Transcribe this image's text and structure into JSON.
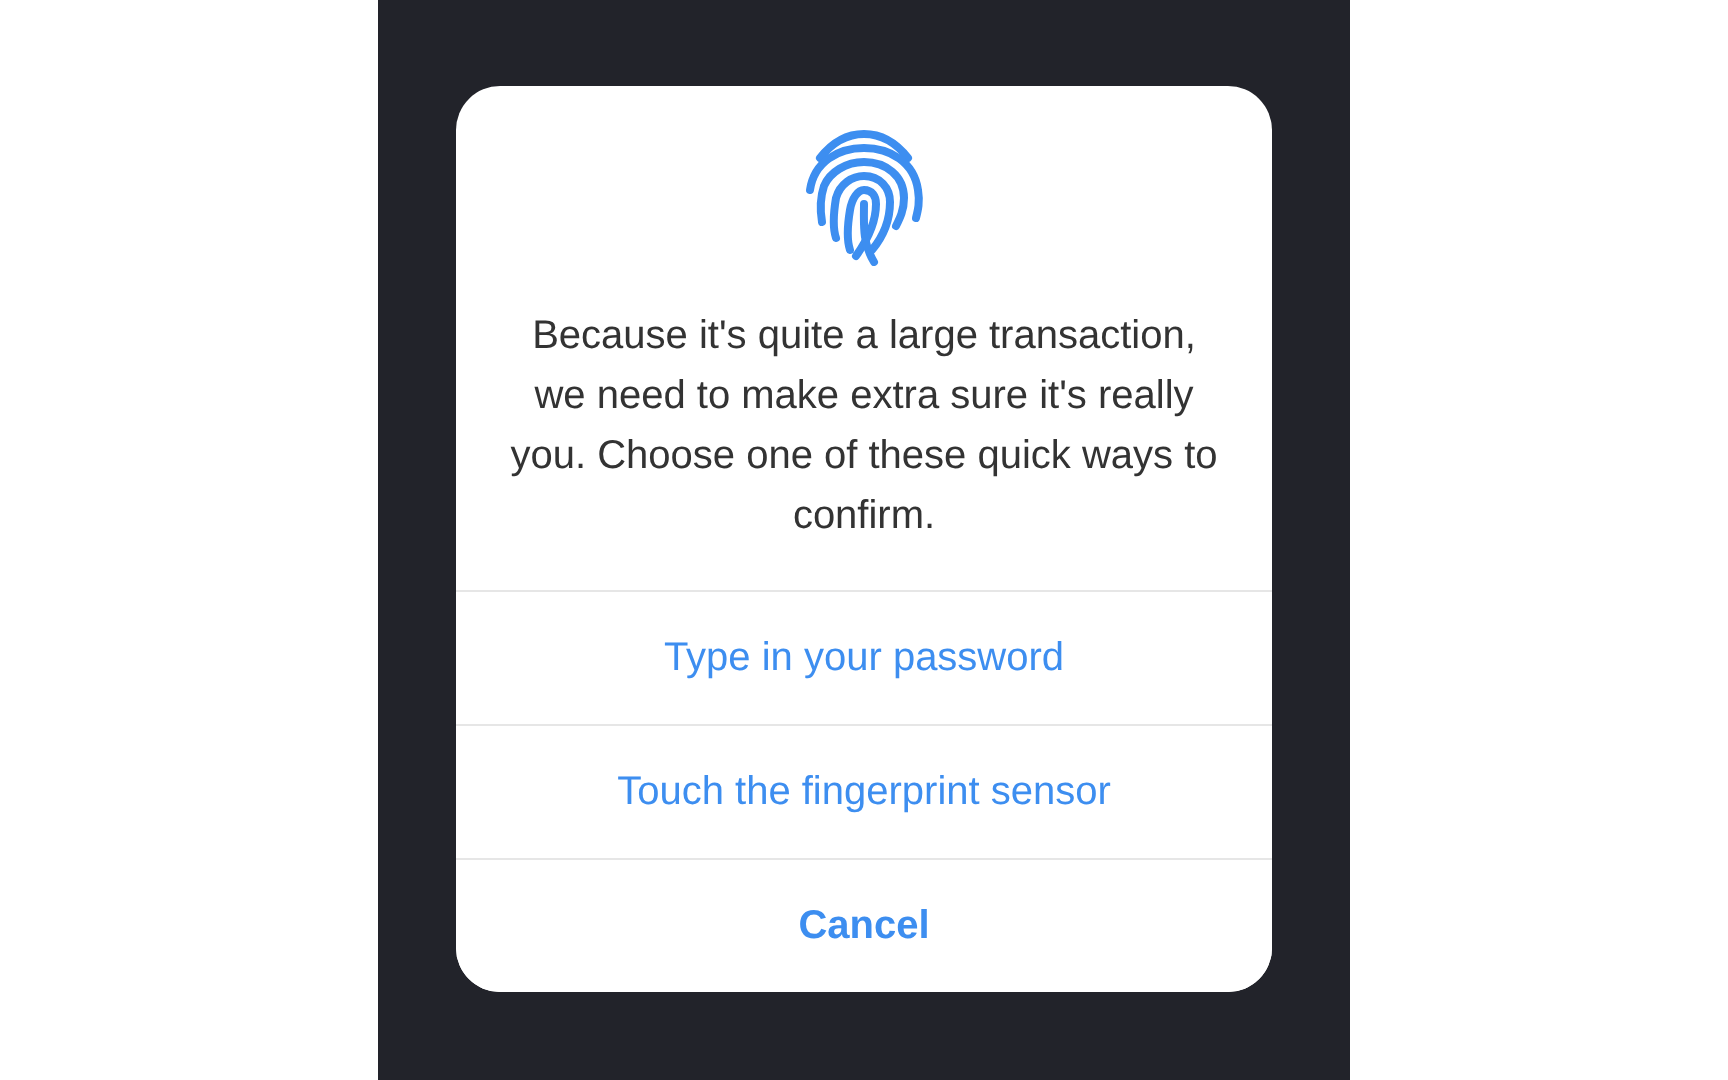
{
  "dialog": {
    "message": "Because it's quite a large transaction, we need to make extra sure it's really you. Choose one of these quick ways to confirm.",
    "actions": [
      {
        "label": "Type in your password",
        "kind": "option"
      },
      {
        "label": "Touch the fingerprint sensor",
        "kind": "option"
      },
      {
        "label": "Cancel",
        "kind": "cancel"
      }
    ]
  }
}
